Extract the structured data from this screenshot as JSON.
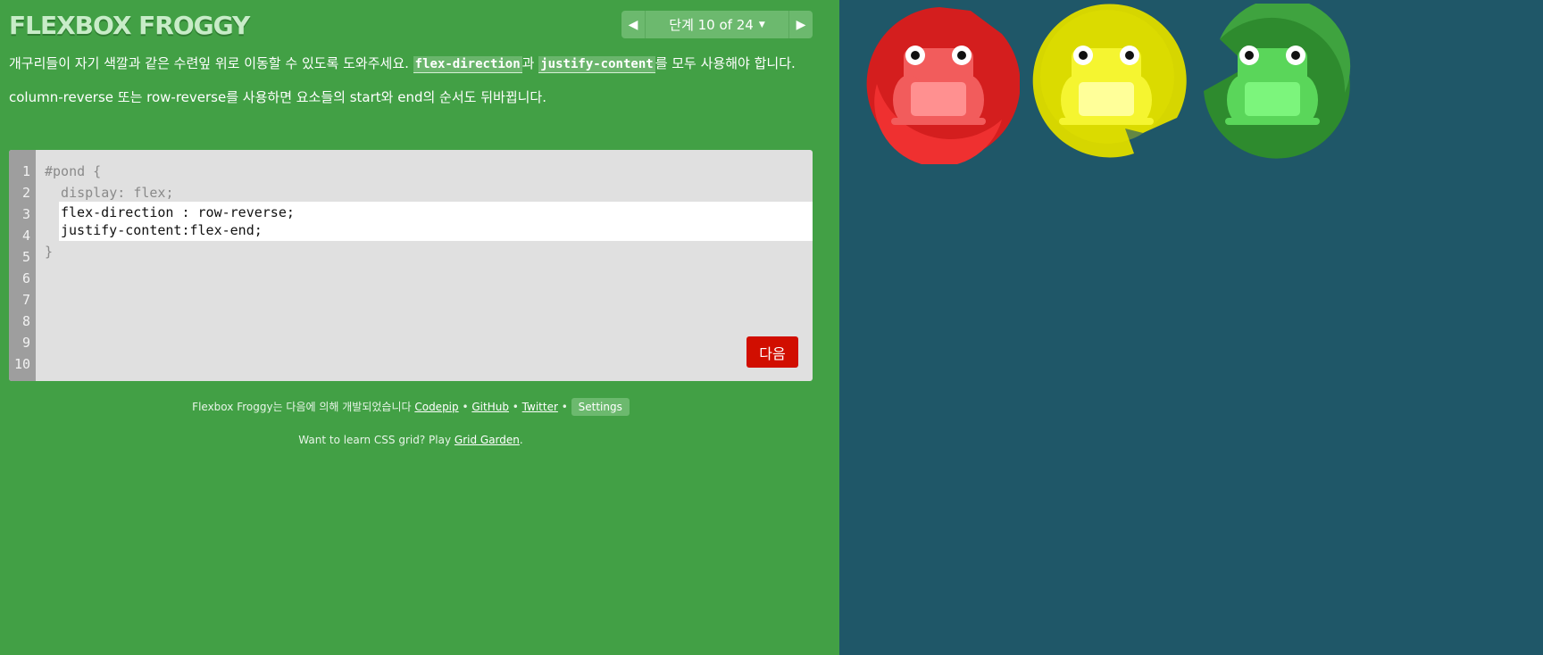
{
  "header": {
    "title": "FLEXBOX FROGGY",
    "level_label": "단계 10 of 24",
    "prev_icon": "left-triangle-icon",
    "next_icon": "right-triangle-icon",
    "caret_icon": "caret-down-icon"
  },
  "instructions": {
    "p1_part1": "개구리들이 자기 색깔과 같은 수련잎 위로 이동할 수 있도록 도와주세요. ",
    "p1_code1": "flex-direction",
    "p1_part2": "과 ",
    "p1_code2": "justify-content",
    "p1_part3": "를 모두 사용해야 합니다.",
    "p2": "column-reverse 또는 row-reverse를 사용하면 요소들의 start와 end의 순서도 뒤바뀝니다."
  },
  "editor": {
    "line_numbers": [
      "1",
      "2",
      "3",
      "4",
      "5",
      "6",
      "7",
      "8",
      "9",
      "10"
    ],
    "line1": "#pond {",
    "line2": "  display: flex;",
    "input_value": "flex-direction : row-reverse;\njustify-content:flex-end;",
    "closing": "}",
    "next_label": "다음"
  },
  "footer": {
    "credits_prefix": "Flexbox Froggy는 다음에 의해 개발되었습니다 ",
    "codepip": "Codepip",
    "sep": " • ",
    "github": "GitHub",
    "twitter": "Twitter",
    "settings": "Settings",
    "grid_prefix": "Want to learn CSS grid? Play ",
    "grid_link": "Grid Garden",
    "grid_suffix": "."
  },
  "colors": {
    "sidebar_bg": "#42a045",
    "pond_bg": "#1f5768",
    "next_button": "#d10e00",
    "red_pad": "#d41e1e",
    "yellow_pad": "#d6d600",
    "green_pad": "#2e8b2e",
    "red_frog": "#f25c5c",
    "yellow_frog": "#f5f530",
    "green_frog": "#5ad65a"
  },
  "pond": {
    "frogs": [
      "red",
      "yellow",
      "green"
    ],
    "frog_icon": "frog-icon",
    "lilypad_icon": "lilypad-icon"
  }
}
